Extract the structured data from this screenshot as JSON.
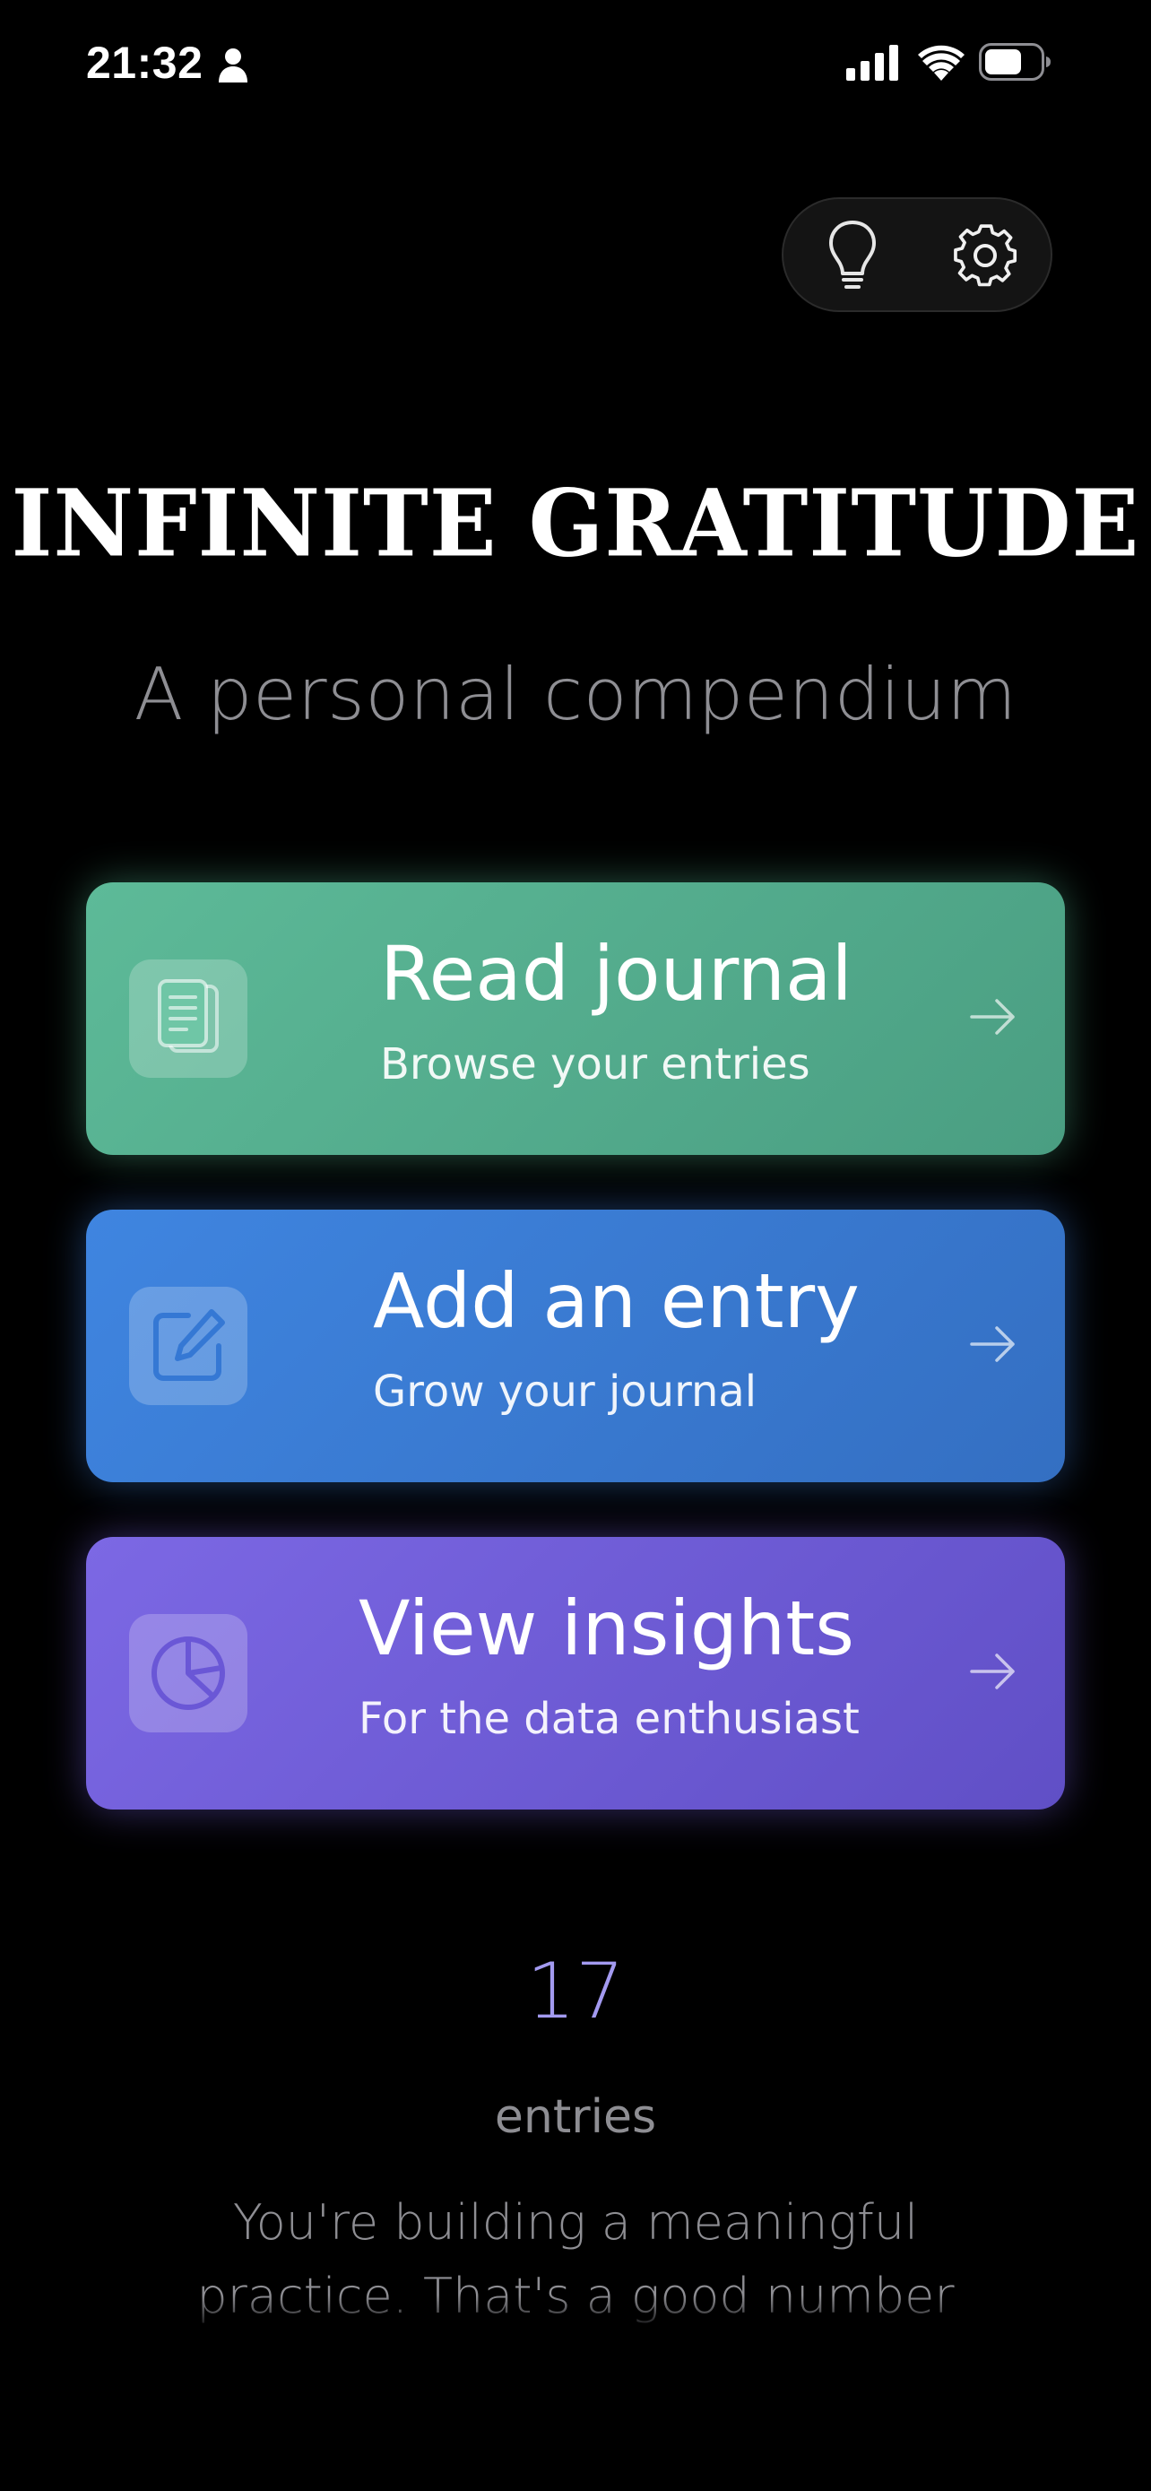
{
  "status_bar": {
    "time": "21:32",
    "icons": [
      "person-icon",
      "cellular-signal-icon",
      "wifi-icon",
      "battery-icon"
    ]
  },
  "toolbar": {
    "icons": [
      "lightbulb-icon",
      "gear-icon"
    ]
  },
  "header": {
    "title": "INFINITE GRATITUDE",
    "subtitle": "A personal compendium"
  },
  "cards": [
    {
      "title": "Read journal",
      "subtitle": "Browse your entries",
      "icon": "journal-pages-icon",
      "color": "#55b08e"
    },
    {
      "title": "Add an entry",
      "subtitle": "Grow your journal",
      "icon": "edit-square-icon",
      "color": "#3a7bd5"
    },
    {
      "title": "View insights",
      "subtitle": "For the data enthusiast",
      "icon": "pie-chart-icon",
      "color": "#6e5ad8"
    }
  ],
  "stats": {
    "count": "17",
    "count_label": "entries",
    "message": "You're building a meaningful practice. That's a good number of items to be grateful for!"
  },
  "colors": {
    "background": "#000000",
    "count_accent": "#a39af0",
    "muted_text": "#8e8e93"
  }
}
